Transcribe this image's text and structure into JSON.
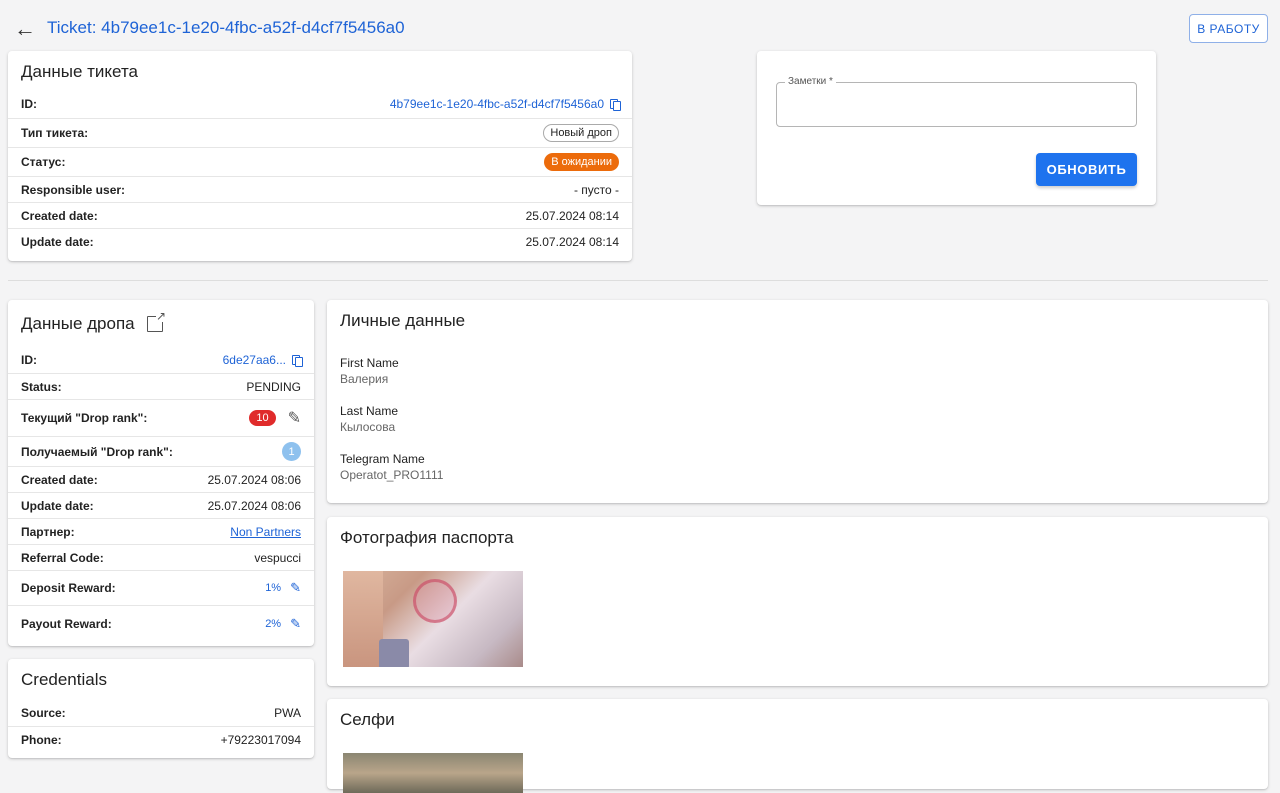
{
  "header": {
    "back_icon": "arrow-left-icon",
    "title": "Ticket: 4b79ee1c-1e20-4fbc-a52f-d4cf7f5456a0",
    "work_button": "В РАБОТУ"
  },
  "ticket": {
    "title": "Данные тикета",
    "rows": [
      {
        "label": "ID:",
        "value": "4b79ee1c-1e20-4fbc-a52f-d4cf7f5456a0"
      },
      {
        "label": "Тип тикета:",
        "value": "Новый дроп"
      },
      {
        "label": "Статус:",
        "value": "В ожидании"
      },
      {
        "label": "Responsible user:",
        "value": "- пусто -"
      },
      {
        "label": "Created date:",
        "value": "25.07.2024 08:14"
      },
      {
        "label": "Update date:",
        "value": "25.07.2024 08:14"
      }
    ],
    "status_color": "#ec6b0b"
  },
  "notes": {
    "label": "Заметки *",
    "value": "",
    "update_button": "ОБНОВИТЬ"
  },
  "drop": {
    "title": "Данные дропа",
    "rows": [
      {
        "label": "ID:",
        "value": "6de27aa6..."
      },
      {
        "label": "Status:",
        "value": "PENDING"
      },
      {
        "label": "Текущий \"Drop rank\":",
        "value": "10"
      },
      {
        "label": "Получаемый \"Drop rank\":",
        "value": "1"
      },
      {
        "label": "Created date:",
        "value": "25.07.2024 08:06"
      },
      {
        "label": "Update date:",
        "value": "25.07.2024 08:06"
      },
      {
        "label": "Партнер:",
        "value": "Non Partners"
      },
      {
        "label": "Referral Code:",
        "value": "vespucci"
      },
      {
        "label": "Deposit Reward:",
        "value": "1%"
      },
      {
        "label": "Payout Reward:",
        "value": "2%"
      }
    ]
  },
  "credentials": {
    "title": "Credentials",
    "rows": [
      {
        "label": "Source:",
        "value": "PWA"
      },
      {
        "label": "Phone:",
        "value": "+79223017094"
      }
    ]
  },
  "personal": {
    "title": "Личные данные",
    "fields": [
      {
        "label": "First Name",
        "value": "Валерия"
      },
      {
        "label": "Last Name",
        "value": "Кылосова"
      },
      {
        "label": "Telegram Name",
        "value": "Operatot_PRO1111"
      }
    ]
  },
  "passport": {
    "title": "Фотография паспорта"
  },
  "selfie": {
    "title": "Селфи"
  },
  "colors": {
    "accent": "#1e63d6",
    "primary_button": "#1e73ee",
    "rank_badge": "#e02b2b",
    "next_rank_badge": "#8ec1ee"
  }
}
